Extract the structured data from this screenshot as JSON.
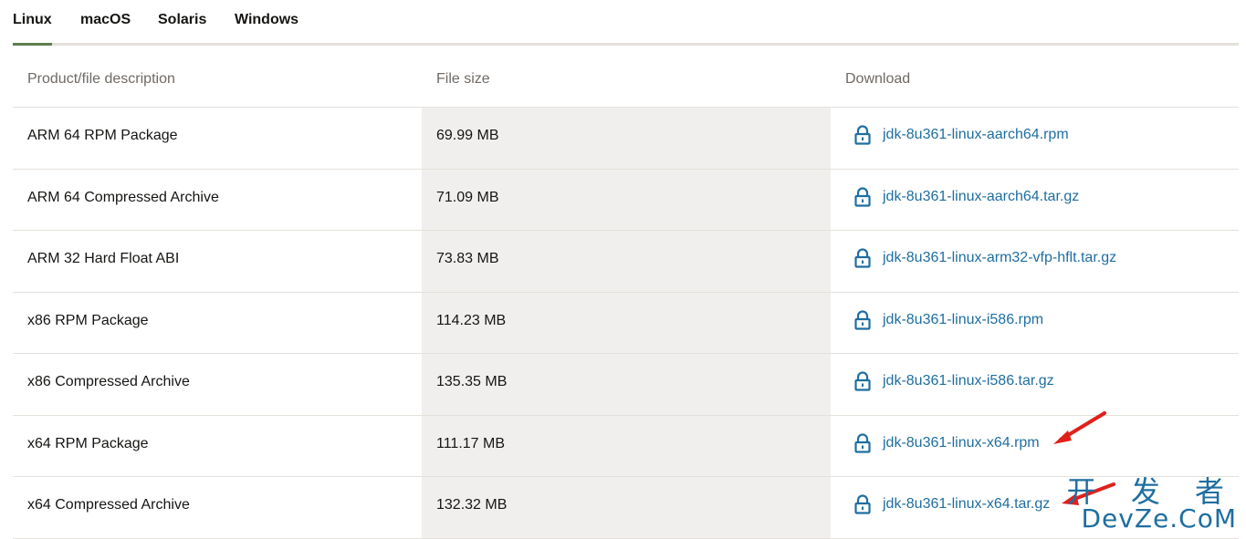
{
  "tabs": [
    {
      "label": "Linux",
      "active": true
    },
    {
      "label": "macOS",
      "active": false
    },
    {
      "label": "Solaris",
      "active": false
    },
    {
      "label": "Windows",
      "active": false
    }
  ],
  "table": {
    "headers": [
      "Product/file description",
      "File size",
      "Download"
    ],
    "rows": [
      {
        "description": "ARM 64 RPM Package",
        "size": "69.99 MB",
        "file": "jdk-8u361-linux-aarch64.rpm"
      },
      {
        "description": "ARM 64 Compressed Archive",
        "size": "71.09 MB",
        "file": "jdk-8u361-linux-aarch64.tar.gz"
      },
      {
        "description": "ARM 32 Hard Float ABI",
        "size": "73.83 MB",
        "file": "jdk-8u361-linux-arm32-vfp-hflt.tar.gz"
      },
      {
        "description": "x86 RPM Package",
        "size": "114.23 MB",
        "file": "jdk-8u361-linux-i586.rpm"
      },
      {
        "description": "x86 Compressed Archive",
        "size": "135.35 MB",
        "file": "jdk-8u361-linux-i586.tar.gz"
      },
      {
        "description": "x64 RPM Package",
        "size": "111.17 MB",
        "file": "jdk-8u361-linux-x64.rpm"
      },
      {
        "description": "x64 Compressed Archive",
        "size": "132.32 MB",
        "file": "jdk-8u361-linux-x64.tar.gz"
      }
    ]
  },
  "icons": {
    "download": "lock-icon",
    "annotation": "red-arrow-icon"
  },
  "colors": {
    "link": "#1f6ea0",
    "active_tab": "#5f7d4f",
    "arrow": "#e0201b",
    "size_column_bg": "#f1efed"
  },
  "watermark": {
    "line1": "开 发 者",
    "line2": "DevZe.CoM"
  }
}
